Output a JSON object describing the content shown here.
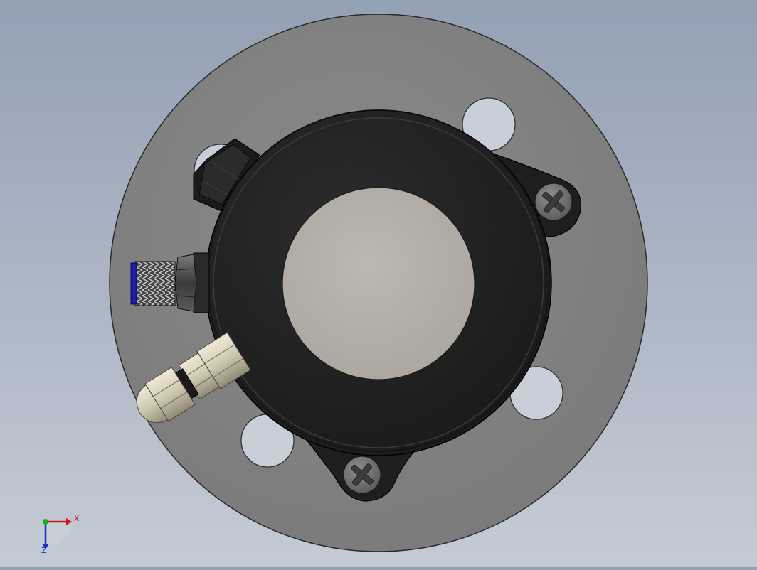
{
  "viewport": {
    "background_top": "#93a1b4",
    "background_bottom": "#c5cbd5"
  },
  "model": {
    "flange_color": "#848484",
    "housing_color": "#232323",
    "center_disc_color": "#b5b0aa",
    "cable_gland_color": "#d6cfba",
    "connector_ring_color": "#1c1ca8"
  },
  "triad": {
    "x_label": "X",
    "z_label": "Z",
    "x_color": "#d01818",
    "y_color": "#18b018",
    "z_color": "#1830c8"
  }
}
